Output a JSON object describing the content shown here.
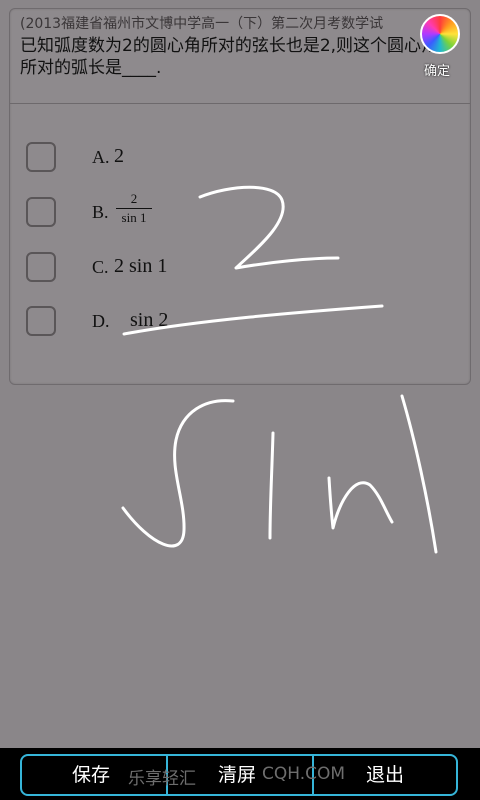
{
  "question": {
    "source": "(2013福建省福州市文博中学高一（下）第二次月考数学试",
    "text": "已知弧度数为2的圆心角所对的弦长也是2,则这个圆心角所对的弧长是____.",
    "options": [
      {
        "letter": "A.",
        "value": "2"
      },
      {
        "letter": "B.",
        "numerator": "2",
        "denominator": "sin 1"
      },
      {
        "letter": "C.",
        "value": "2 sin 1"
      },
      {
        "letter": "D.",
        "value": "sin 2"
      }
    ]
  },
  "header": {
    "confirm_label": "确定",
    "palette_icon": "color-palette-icon"
  },
  "handwriting": {
    "strokes_description_colors": "#ffffff"
  },
  "toolbar": {
    "save_label": "保存",
    "clear_label": "清屏",
    "exit_label": "退出",
    "watermark_left": "乐享轻汇",
    "watermark_right": "CQH.COM",
    "accent_color": "#36b5d9"
  }
}
